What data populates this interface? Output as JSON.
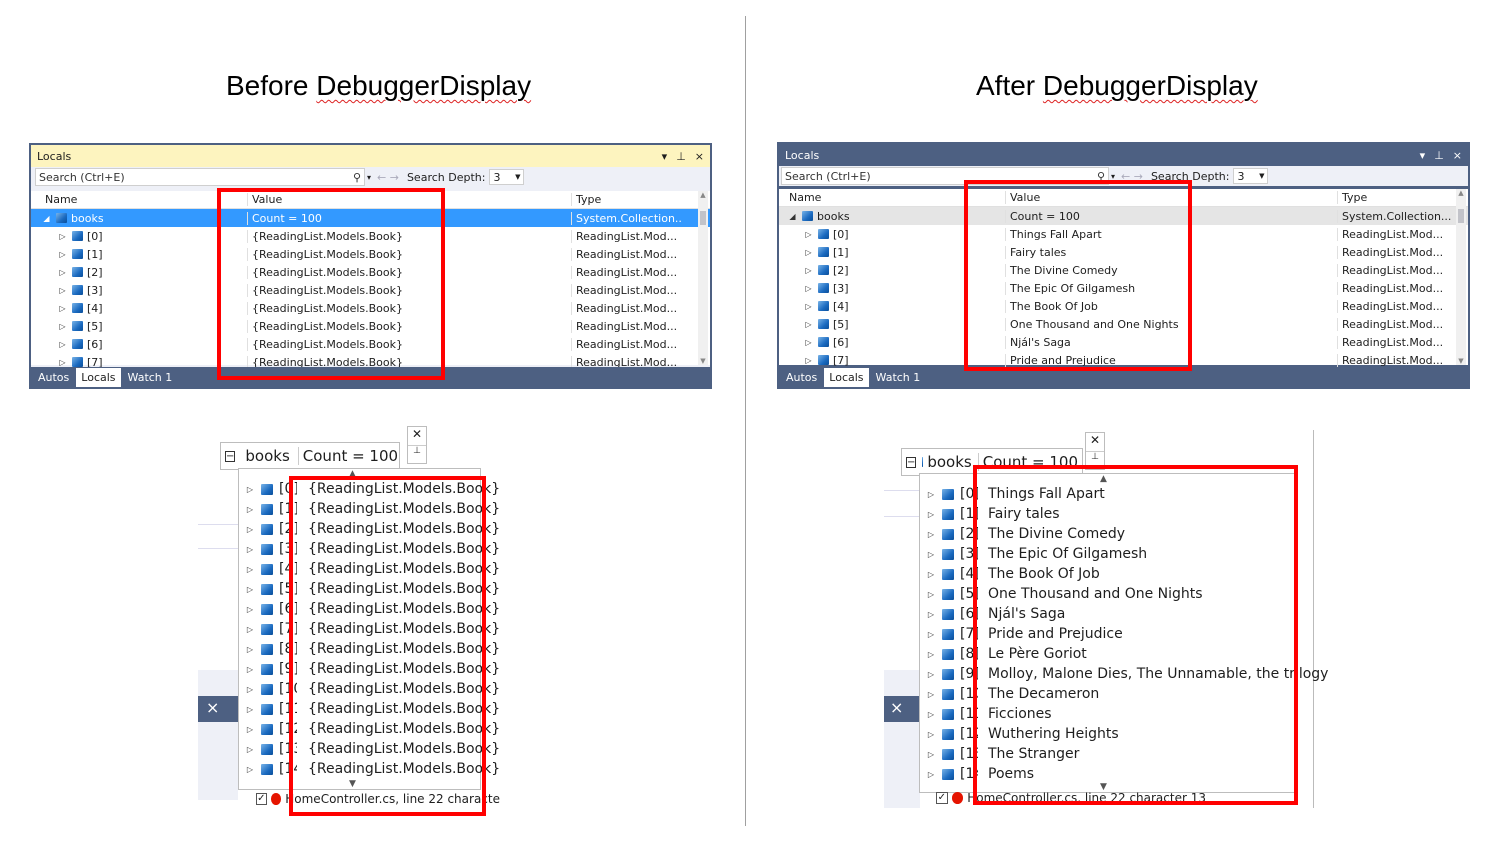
{
  "headings": {
    "before": {
      "prefix": "Before ",
      "word": "DebuggerDisplay"
    },
    "after": {
      "prefix": "After ",
      "word": "DebuggerDisplay"
    }
  },
  "locals_window": {
    "title": "Locals",
    "search_placeholder": "Search (Ctrl+E)",
    "depth_label": "Search Depth:",
    "depth_value": "3",
    "columns": {
      "name": "Name",
      "value": "Value",
      "type": "Type"
    },
    "tabs": [
      "Autos",
      "Locals",
      "Watch 1"
    ],
    "active_tab": "Locals"
  },
  "before": {
    "rows": [
      {
        "name": "books",
        "value": "Count = 100",
        "type": "System.Collection..."
      },
      {
        "name": "[0]",
        "value": "{ReadingList.Models.Book}",
        "type": "ReadingList.Mod..."
      },
      {
        "name": "[1]",
        "value": "{ReadingList.Models.Book}",
        "type": "ReadingList.Mod..."
      },
      {
        "name": "[2]",
        "value": "{ReadingList.Models.Book}",
        "type": "ReadingList.Mod..."
      },
      {
        "name": "[3]",
        "value": "{ReadingList.Models.Book}",
        "type": "ReadingList.Mod..."
      },
      {
        "name": "[4]",
        "value": "{ReadingList.Models.Book}",
        "type": "ReadingList.Mod..."
      },
      {
        "name": "[5]",
        "value": "{ReadingList.Models.Book}",
        "type": "ReadingList.Mod..."
      },
      {
        "name": "[6]",
        "value": "{ReadingList.Models.Book}",
        "type": "ReadingList.Mod..."
      },
      {
        "name": "[7]",
        "value": "{ReadingList.Models.Book}",
        "type": "ReadingList.Mod..."
      }
    ],
    "datatip": {
      "name": "books",
      "value": "Count = 100",
      "rows": [
        {
          "idx": "[0]",
          "value": "{ReadingList.Models.Book}"
        },
        {
          "idx": "[1]",
          "value": "{ReadingList.Models.Book}"
        },
        {
          "idx": "[2]",
          "value": "{ReadingList.Models.Book}"
        },
        {
          "idx": "[3]",
          "value": "{ReadingList.Models.Book}"
        },
        {
          "idx": "[4]",
          "value": "{ReadingList.Models.Book}"
        },
        {
          "idx": "[5]",
          "value": "{ReadingList.Models.Book}"
        },
        {
          "idx": "[6]",
          "value": "{ReadingList.Models.Book}"
        },
        {
          "idx": "[7]",
          "value": "{ReadingList.Models.Book}"
        },
        {
          "idx": "[8]",
          "value": "{ReadingList.Models.Book}"
        },
        {
          "idx": "[9]",
          "value": "{ReadingList.Models.Book}"
        },
        {
          "idx": "[10]",
          "value": "{ReadingList.Models.Book}"
        },
        {
          "idx": "[11]",
          "value": "{ReadingList.Models.Book}"
        },
        {
          "idx": "[12]",
          "value": "{ReadingList.Models.Book}"
        },
        {
          "idx": "[13]",
          "value": "{ReadingList.Models.Book}"
        },
        {
          "idx": "[14]",
          "value": "{ReadingList.Models.Book}"
        }
      ],
      "bottom_text": "HomeController.cs, line 22 characte"
    }
  },
  "after": {
    "rows": [
      {
        "name": "books",
        "value": "Count = 100",
        "type": "System.Collection..."
      },
      {
        "name": "[0]",
        "value": "Things Fall Apart",
        "type": "ReadingList.Mod..."
      },
      {
        "name": "[1]",
        "value": "Fairy tales",
        "type": "ReadingList.Mod..."
      },
      {
        "name": "[2]",
        "value": "The Divine Comedy",
        "type": "ReadingList.Mod..."
      },
      {
        "name": "[3]",
        "value": "The Epic Of Gilgamesh",
        "type": "ReadingList.Mod..."
      },
      {
        "name": "[4]",
        "value": "The Book Of Job",
        "type": "ReadingList.Mod..."
      },
      {
        "name": "[5]",
        "value": "One Thousand and One Nights",
        "type": "ReadingList.Mod..."
      },
      {
        "name": "[6]",
        "value": "Njál's Saga",
        "type": "ReadingList.Mod..."
      },
      {
        "name": "[7]",
        "value": "Pride and Prejudice",
        "type": "ReadingList.Mod..."
      }
    ],
    "datatip": {
      "name": "books",
      "value": "Count = 100",
      "rows": [
        {
          "idx": "[0]",
          "value": "Things Fall Apart"
        },
        {
          "idx": "[1]",
          "value": "Fairy tales"
        },
        {
          "idx": "[2]",
          "value": "The Divine Comedy"
        },
        {
          "idx": "[3]",
          "value": "The Epic Of Gilgamesh"
        },
        {
          "idx": "[4]",
          "value": "The Book Of Job"
        },
        {
          "idx": "[5]",
          "value": "One Thousand and One Nights"
        },
        {
          "idx": "[6]",
          "value": "Njál's Saga"
        },
        {
          "idx": "[7]",
          "value": "Pride and Prejudice"
        },
        {
          "idx": "[8]",
          "value": "Le Père Goriot"
        },
        {
          "idx": "[9]",
          "value": "Molloy, Malone Dies, The Unnamable, the trilogy"
        },
        {
          "idx": "[10]",
          "value": "The Decameron"
        },
        {
          "idx": "[11]",
          "value": "Ficciones"
        },
        {
          "idx": "[12]",
          "value": "Wuthering Heights"
        },
        {
          "idx": "[13]",
          "value": "The Stranger"
        },
        {
          "idx": "[14]",
          "value": "Poems"
        }
      ],
      "bottom_text": "HomeController.cs, line 22 character 13"
    }
  },
  "icons": {
    "close": "×",
    "pin": "📌",
    "dropdown": "▼",
    "expand": "▶",
    "collapse": "◢",
    "minus_box": "−",
    "check": "✓"
  },
  "colors": {
    "highlight": "#ff0000",
    "window_border": "#4d6082",
    "selection": "#3399ff"
  }
}
